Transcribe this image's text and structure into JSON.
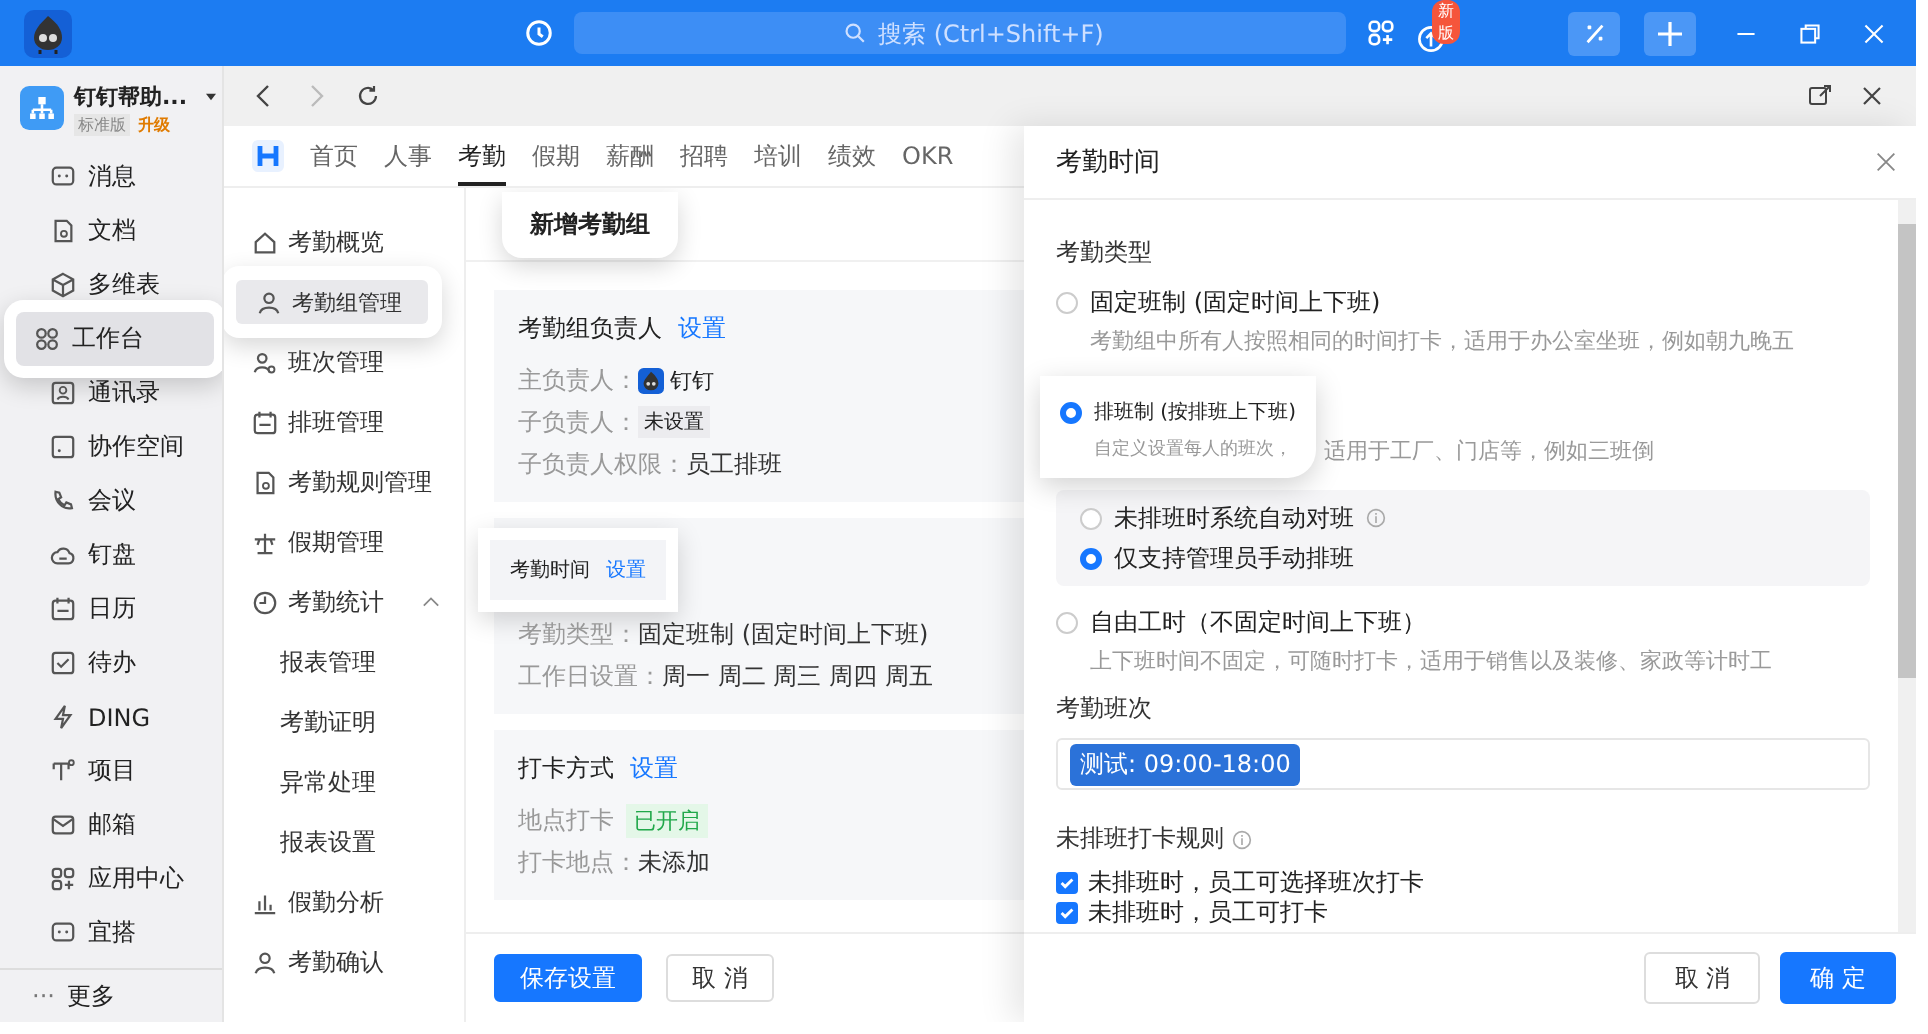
{
  "titlebar": {
    "search_placeholder": "搜索 (Ctrl+Shift+F)",
    "badge": "新版"
  },
  "account": {
    "name": "钉钉帮助...",
    "plan": "标准版",
    "upgrade": "升级"
  },
  "sidebar": {
    "items": [
      {
        "label": "消息",
        "selected": false,
        "highlighted": false
      },
      {
        "label": "文档",
        "selected": false,
        "highlighted": false
      },
      {
        "label": "多维表",
        "selected": false,
        "highlighted": false
      },
      {
        "label": "工作台",
        "selected": true,
        "highlighted": true
      },
      {
        "label": "通讯录",
        "selected": false,
        "highlighted": false
      },
      {
        "label": "协作空间",
        "selected": false,
        "highlighted": false
      },
      {
        "label": "会议",
        "selected": false,
        "highlighted": false
      },
      {
        "label": "钉盘",
        "selected": false,
        "highlighted": false
      },
      {
        "label": "日历",
        "selected": false,
        "highlighted": false
      },
      {
        "label": "待办",
        "selected": false,
        "highlighted": false
      },
      {
        "label": "DING",
        "selected": false,
        "highlighted": false
      },
      {
        "label": "项目",
        "selected": false,
        "highlighted": false
      },
      {
        "label": "邮箱",
        "selected": false,
        "highlighted": false
      },
      {
        "label": "应用中心",
        "selected": false,
        "highlighted": false
      },
      {
        "label": "宜搭",
        "selected": false,
        "highlighted": false
      }
    ],
    "more": {
      "icon": "···",
      "label": "更多"
    }
  },
  "app_tabs": [
    {
      "label": "首页",
      "selected": false
    },
    {
      "label": "人事",
      "selected": false
    },
    {
      "label": "考勤",
      "selected": true
    },
    {
      "label": "假期",
      "selected": false
    },
    {
      "label": "薪酬",
      "selected": false
    },
    {
      "label": "招聘",
      "selected": false
    },
    {
      "label": "培训",
      "selected": false
    },
    {
      "label": "绩效",
      "selected": false
    },
    {
      "label": "OKR",
      "selected": false
    }
  ],
  "menu": [
    {
      "label": "考勤概览",
      "selected": false,
      "highlighted": false
    },
    {
      "label": "考勤组管理",
      "selected": true,
      "highlighted": true
    },
    {
      "label": "班次管理",
      "selected": false,
      "highlighted": false
    },
    {
      "label": "排班管理",
      "selected": false,
      "highlighted": false
    },
    {
      "label": "考勤规则管理",
      "selected": false,
      "highlighted": false
    },
    {
      "label": "假期管理",
      "selected": false,
      "highlighted": false
    },
    {
      "label": "考勤统计",
      "selected": false,
      "highlighted": false,
      "expanded": true,
      "children": [
        {
          "label": "报表管理",
          "selected": false
        },
        {
          "label": "考勤证明",
          "selected": false
        },
        {
          "label": "异常处理",
          "selected": false
        },
        {
          "label": "报表设置",
          "selected": false
        }
      ]
    },
    {
      "label": "假勤分析",
      "selected": false,
      "highlighted": false
    },
    {
      "label": "考勤确认",
      "selected": false,
      "highlighted": false
    }
  ],
  "content": {
    "heading": "新增考勤组",
    "heading_highlighted": true,
    "cards": [
      {
        "title": "考勤组负责人",
        "link": "设置",
        "highlighted": false,
        "rows": [
          {
            "kind": "person",
            "label": "主负责人：",
            "value": "钉钉"
          },
          {
            "kind": "tag",
            "label": "子负责人：",
            "value": "未设置"
          },
          {
            "kind": "text",
            "label": "子负责人权限：",
            "value": "员工排班"
          }
        ]
      },
      {
        "title": "考勤时间",
        "link": "设置",
        "highlighted": true,
        "rows": [
          {
            "kind": "text",
            "label": "考勤类型：",
            "value": "固定班制 (固定时间上下班)"
          },
          {
            "kind": "text",
            "label": "工作日设置：",
            "value": "周一 周二 周三 周四 周五"
          }
        ]
      },
      {
        "title": "打卡方式",
        "link": "设置",
        "highlighted": false,
        "rows": [
          {
            "kind": "status",
            "label": "地点打卡",
            "value": "已开启"
          },
          {
            "kind": "text",
            "label": "打卡地点：",
            "value": "未添加"
          }
        ]
      }
    ],
    "save": "保存设置",
    "cancel": "取 消"
  },
  "drawer": {
    "title": "考勤时间",
    "section_type": "考勤类型",
    "options": [
      {
        "label": "固定班制 (固定时间上下班)",
        "desc": "考勤组中所有人按照相同的时间打卡，适用于办公室坐班，例如朝九晚五",
        "selected": false,
        "highlighted": false
      },
      {
        "label": "排班制 (按排班上下班)",
        "desc": "自定义设置每人的班次，",
        "desc_rest": "适用于工厂、门店等，例如三班倒",
        "selected": true,
        "highlighted": true,
        "sub_options": [
          {
            "label": "未排班时系统自动对班",
            "info": true,
            "selected": false
          },
          {
            "label": "仅支持管理员手动排班",
            "info": false,
            "selected": true
          }
        ]
      },
      {
        "label": "自由工时（不固定时间上下班）",
        "desc": "上下班时间不固定，可随时打卡，适用于销售以及装修、家政等计时工",
        "selected": false,
        "highlighted": false
      }
    ],
    "section_shift": "考勤班次",
    "shift_tag": "测试: 09:00-18:00",
    "section_rules": "未排班打卡规则",
    "rules": [
      {
        "label": "未排班时，员工可选择班次打卡",
        "checked": true
      },
      {
        "label": "未排班时，员工可打卡",
        "checked": true
      }
    ],
    "cancel": "取 消",
    "ok": "确 定"
  }
}
